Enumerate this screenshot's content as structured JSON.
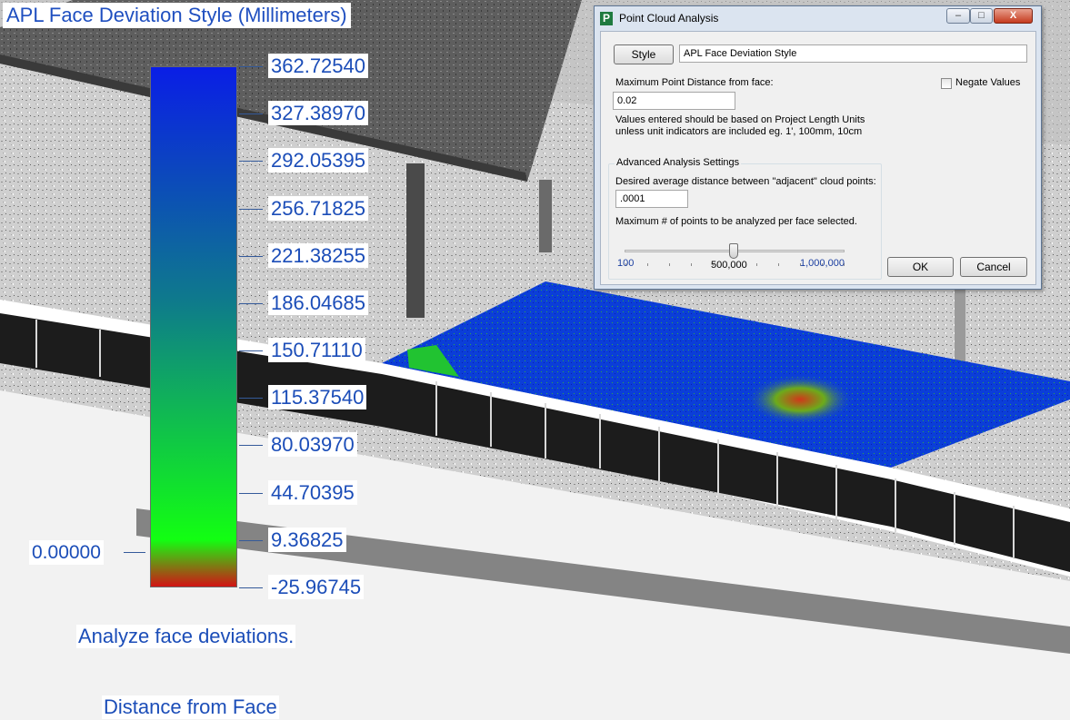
{
  "legend": {
    "title": "APL Face Deviation Style (Millimeters)",
    "tick_labels": [
      "362.72540",
      "327.38970",
      "292.05395",
      "256.71825",
      "221.38255",
      "186.04685",
      "150.71110",
      "115.37540",
      "80.03970",
      "44.70395",
      "9.36825",
      "-25.96745"
    ],
    "zero_label": "0.00000",
    "caption": "Analyze face deviations.",
    "footer": "Distance from Face",
    "colors": {
      "high": "#0a1ee6",
      "mid": "#0e7a8c",
      "zero": "#12ff12",
      "low": "#d21414"
    }
  },
  "dialog": {
    "title": "Point Cloud Analysis",
    "window_controls": {
      "minimize": "–",
      "maximize": "□",
      "close": "X"
    },
    "style_button": "Style",
    "style_value": "APL Face Deviation Style",
    "max_distance_label": "Maximum Point Distance from face:",
    "max_distance_value": "0.02",
    "negate_label": "Negate Values",
    "negate_checked": false,
    "units_note_line1": "Values entered should be based on Project Length Units",
    "units_note_line2": "unless unit indicators are included eg. 1', 100mm, 10cm",
    "advanced_group": "Advanced Analysis Settings",
    "adjacent_label": "Desired average distance between \"adjacent\" cloud points:",
    "adjacent_value": ".0001",
    "max_points_label": "Maximum # of points to be analyzed per face selected.",
    "slider_min": "100",
    "slider_value": "500,000",
    "slider_max": "1,000,000",
    "ok": "OK",
    "cancel": "Cancel"
  }
}
